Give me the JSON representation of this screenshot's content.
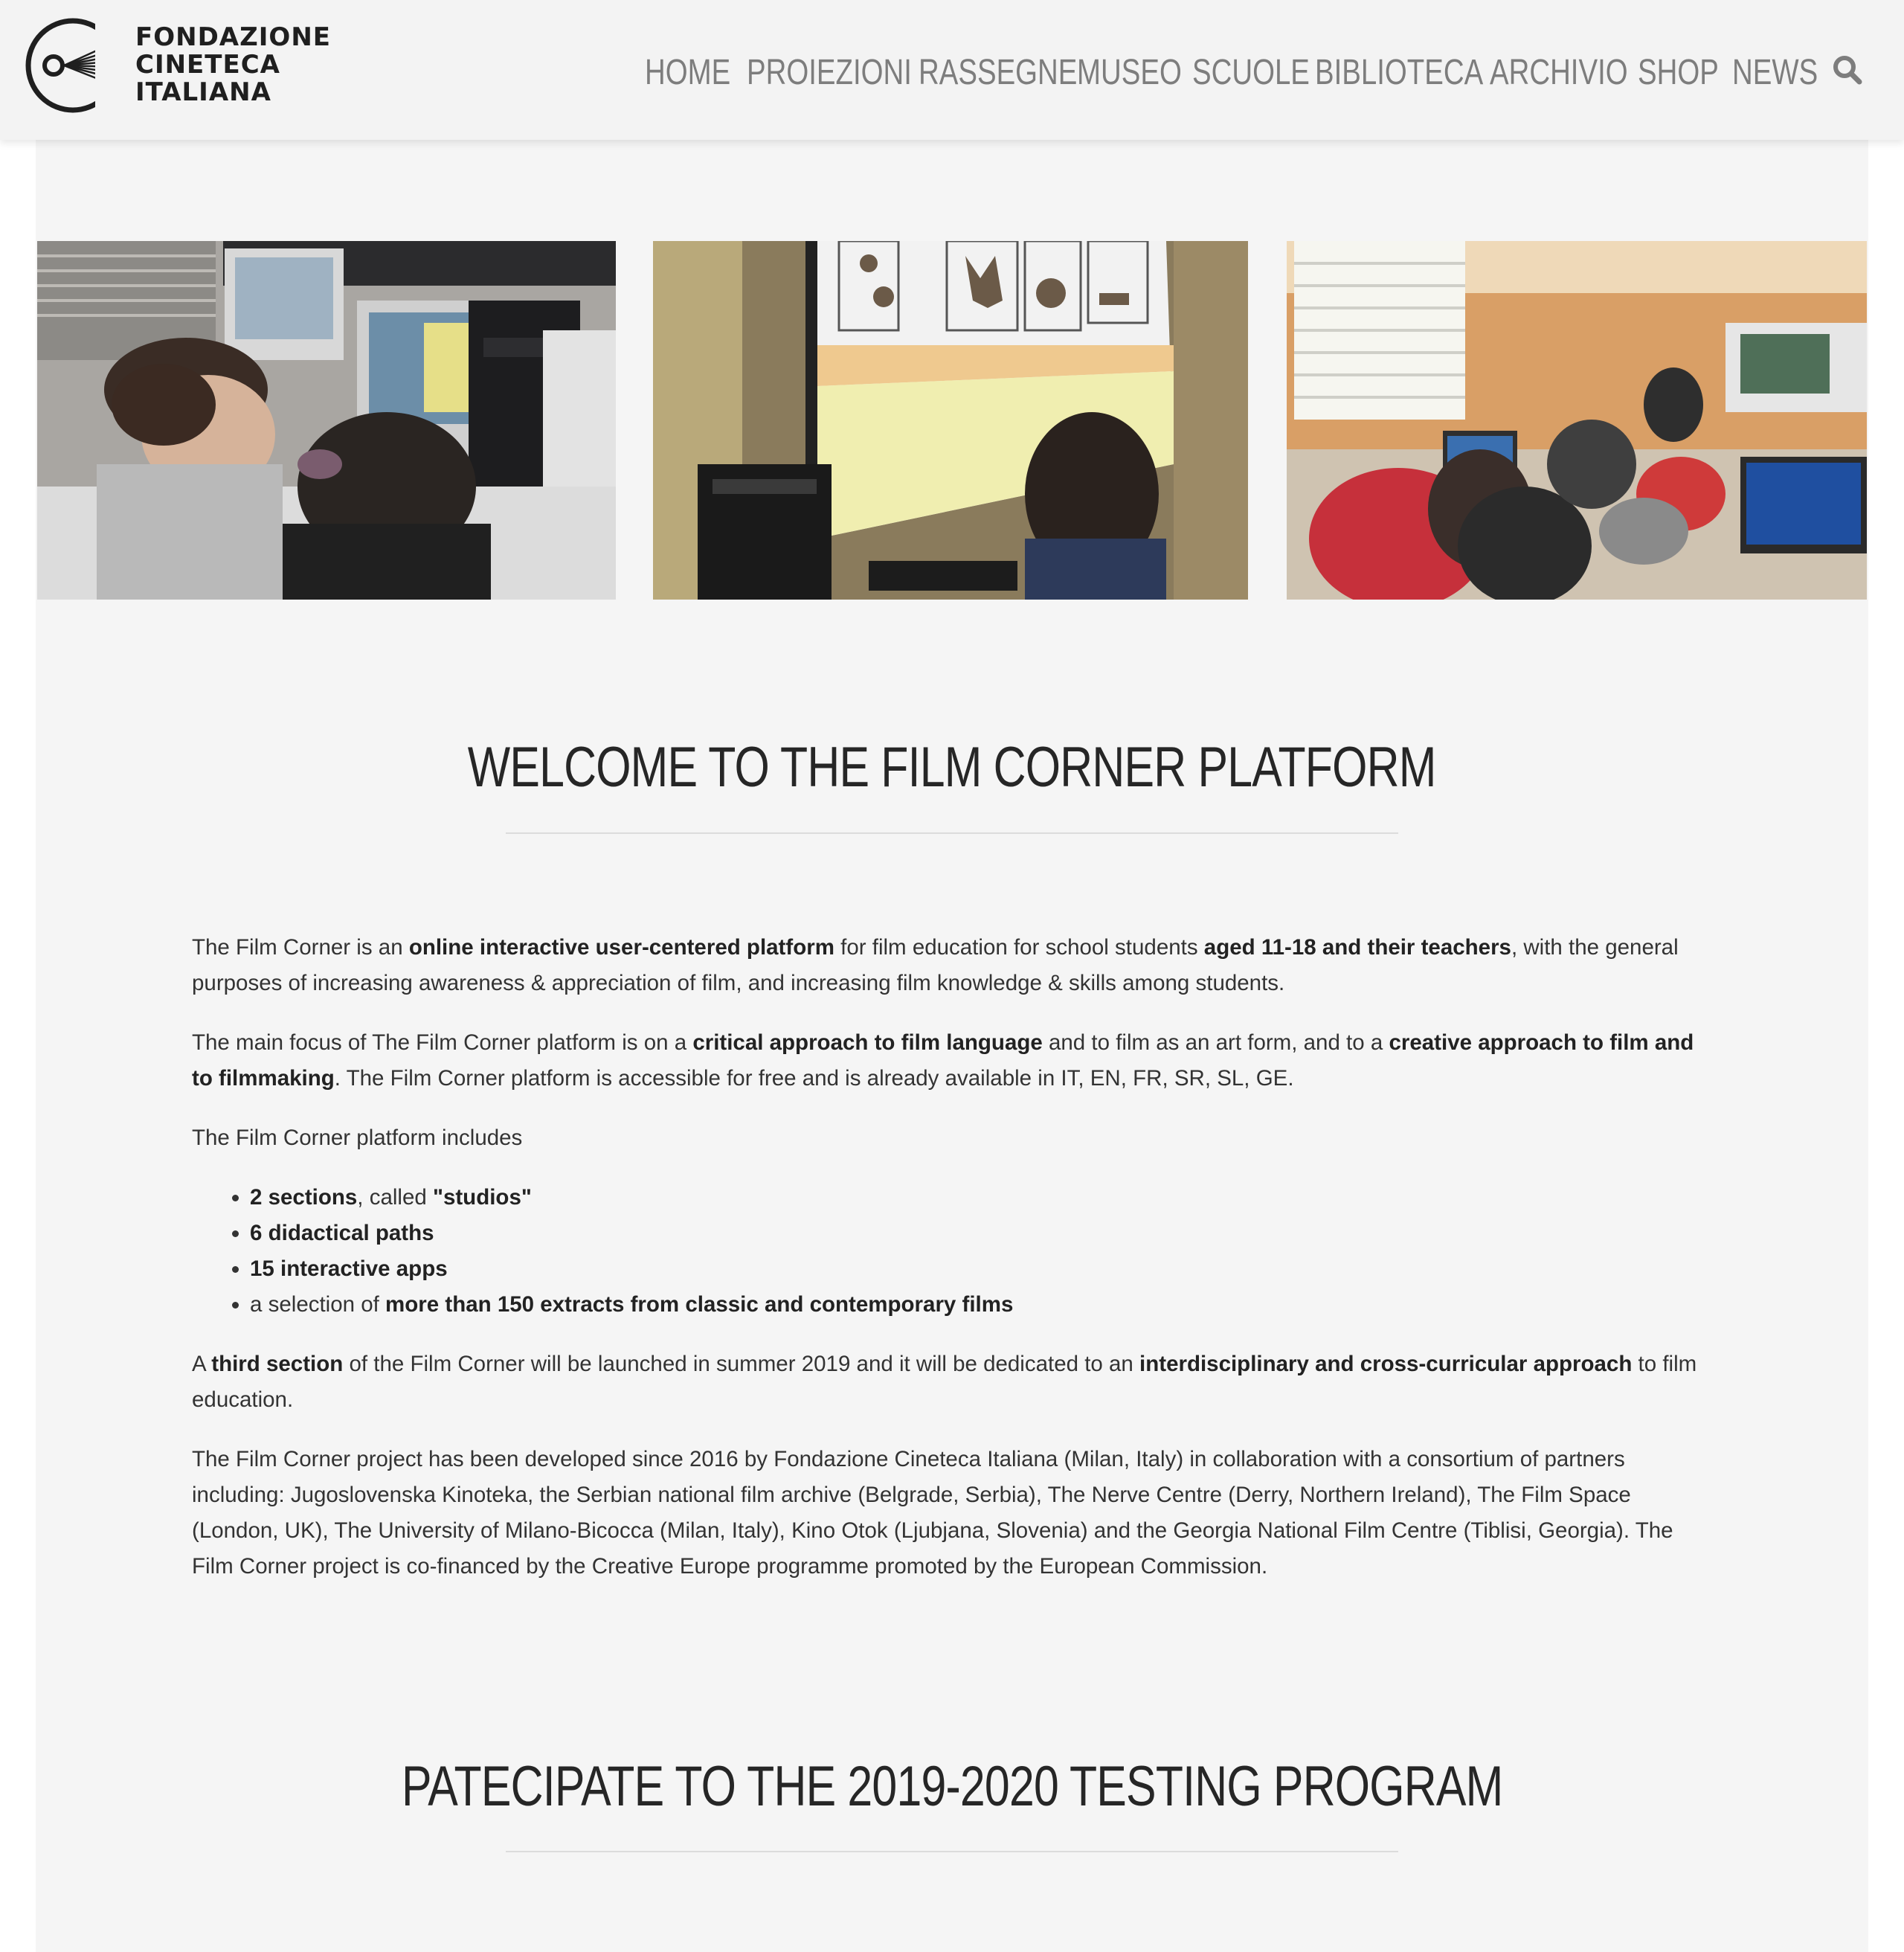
{
  "brand": {
    "line1": "FONDAZIONE",
    "line2": "CINETECA",
    "line3": "ITALIANA"
  },
  "nav": {
    "items": [
      "HOME",
      "PROIEZIONI",
      "RASSEGNE",
      "MUSEO",
      "SCUOLE",
      "BIBLIOTECA",
      "ARCHIVIO",
      "SHOP",
      "NEWS"
    ],
    "search_icon": "search-icon"
  },
  "colors": {
    "header_bg": "#f3f3f3",
    "page_bg": "#f5f5f5",
    "nav_text": "#7d7d7d",
    "body_text": "#333333",
    "heading": "#262626"
  },
  "welcome": {
    "title": "WELCOME TO THE FILM CORNER PLATFORM",
    "p1": {
      "a": "The Film Corner is an ",
      "b1": "online interactive user-centered platform",
      "c": " for film education for school students ",
      "b2": "aged 11-18 and their teachers",
      "d": ", with the general purposes of increasing awareness & appreciation of film, and increasing film knowledge & skills among students."
    },
    "p2": {
      "a": "The main focus of The Film Corner platform is on a ",
      "b1": "critical approach to film language",
      "c": " and to film as an art form, and to a ",
      "b2": "creative approach to film and to filmmaking",
      "d": ". The Film Corner platform is accessible for free and is already available in IT, EN, FR, SR, SL, GE."
    },
    "p3": "The Film Corner platform includes",
    "list": {
      "i1_b": "2 sections",
      "i1_t": ", called ",
      "i1_b2": "\"studios\"",
      "i2_b": "6 didactical paths",
      "i3_b": "15 interactive apps",
      "i4_t": "a selection of ",
      "i4_b": "more than 150 extracts from classic and contemporary films"
    },
    "p4": {
      "a": "A ",
      "b1": "third section",
      "c": " of the Film Corner will be launched in summer 2019 and it will be dedicated to an ",
      "b2": "interdisciplinary and cross-curricular approach",
      "d": " to film education."
    },
    "p5": "The Film Corner project has been developed since 2016 by Fondazione Cineteca Italiana (Milan, Italy) in collaboration with a consortium of partners including: Jugoslovenska Kinoteka, the Serbian national film archive (Belgrade, Serbia), The Nerve Centre (Derry, Northern Ireland), The Film Space (London, UK), The University of Milano-Bicocca (Milan, Italy), Kino Otok (Ljubjana, Slovenia) and the Georgia National Film Centre (Tiblisi, Georgia). The Film Corner project is co-financed by the Creative Europe programme promoted by the European Commission."
  },
  "testing": {
    "title": "PATECIPATE TO THE 2019-2020 TESTING PROGRAM"
  }
}
